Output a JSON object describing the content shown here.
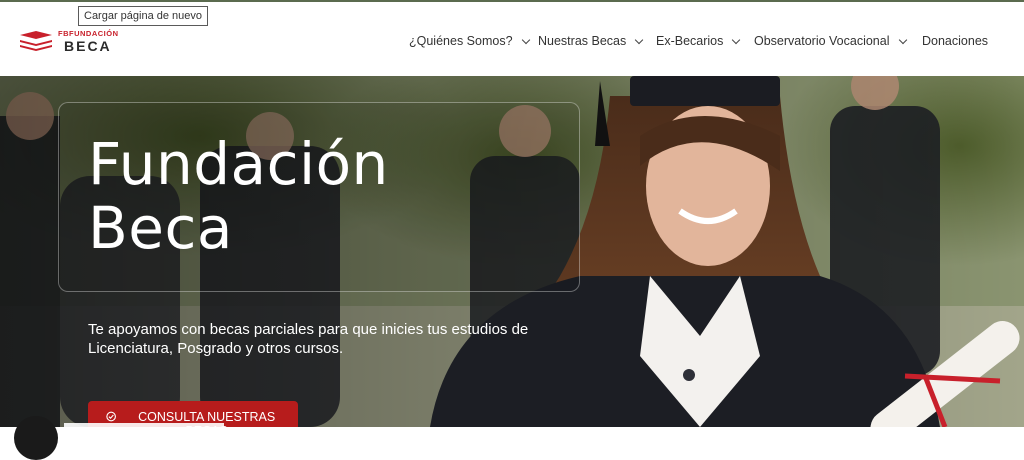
{
  "browser": {
    "tooltip": "Cargar página de nuevo"
  },
  "logo": {
    "small": "FBFUNDACIÓN",
    "big": "BECA",
    "icon": "stacked-books-logo-icon",
    "brand_color": "#c8202b"
  },
  "nav": {
    "items": [
      {
        "label": "¿Quiénes Somos?",
        "has_dropdown": true
      },
      {
        "label": "Nuestras Becas",
        "has_dropdown": true
      },
      {
        "label": "Ex-Becarios",
        "has_dropdown": true
      },
      {
        "label": "Observatorio Vocacional",
        "has_dropdown": true
      },
      {
        "label": "Donaciones",
        "has_dropdown": false
      }
    ]
  },
  "hero": {
    "title_line1": "Fundación",
    "title_line2": "Beca",
    "subtitle": "Te apoyamos con becas parciales para que inicies tus estudios de Licenciatura, Posgrado y otros cursos.",
    "cta_label": "CONSULTA NUESTRAS BECAS",
    "cta_icon": "check-circle-icon",
    "cta_color": "#b71c1c",
    "image": "graduate-student-photo"
  }
}
